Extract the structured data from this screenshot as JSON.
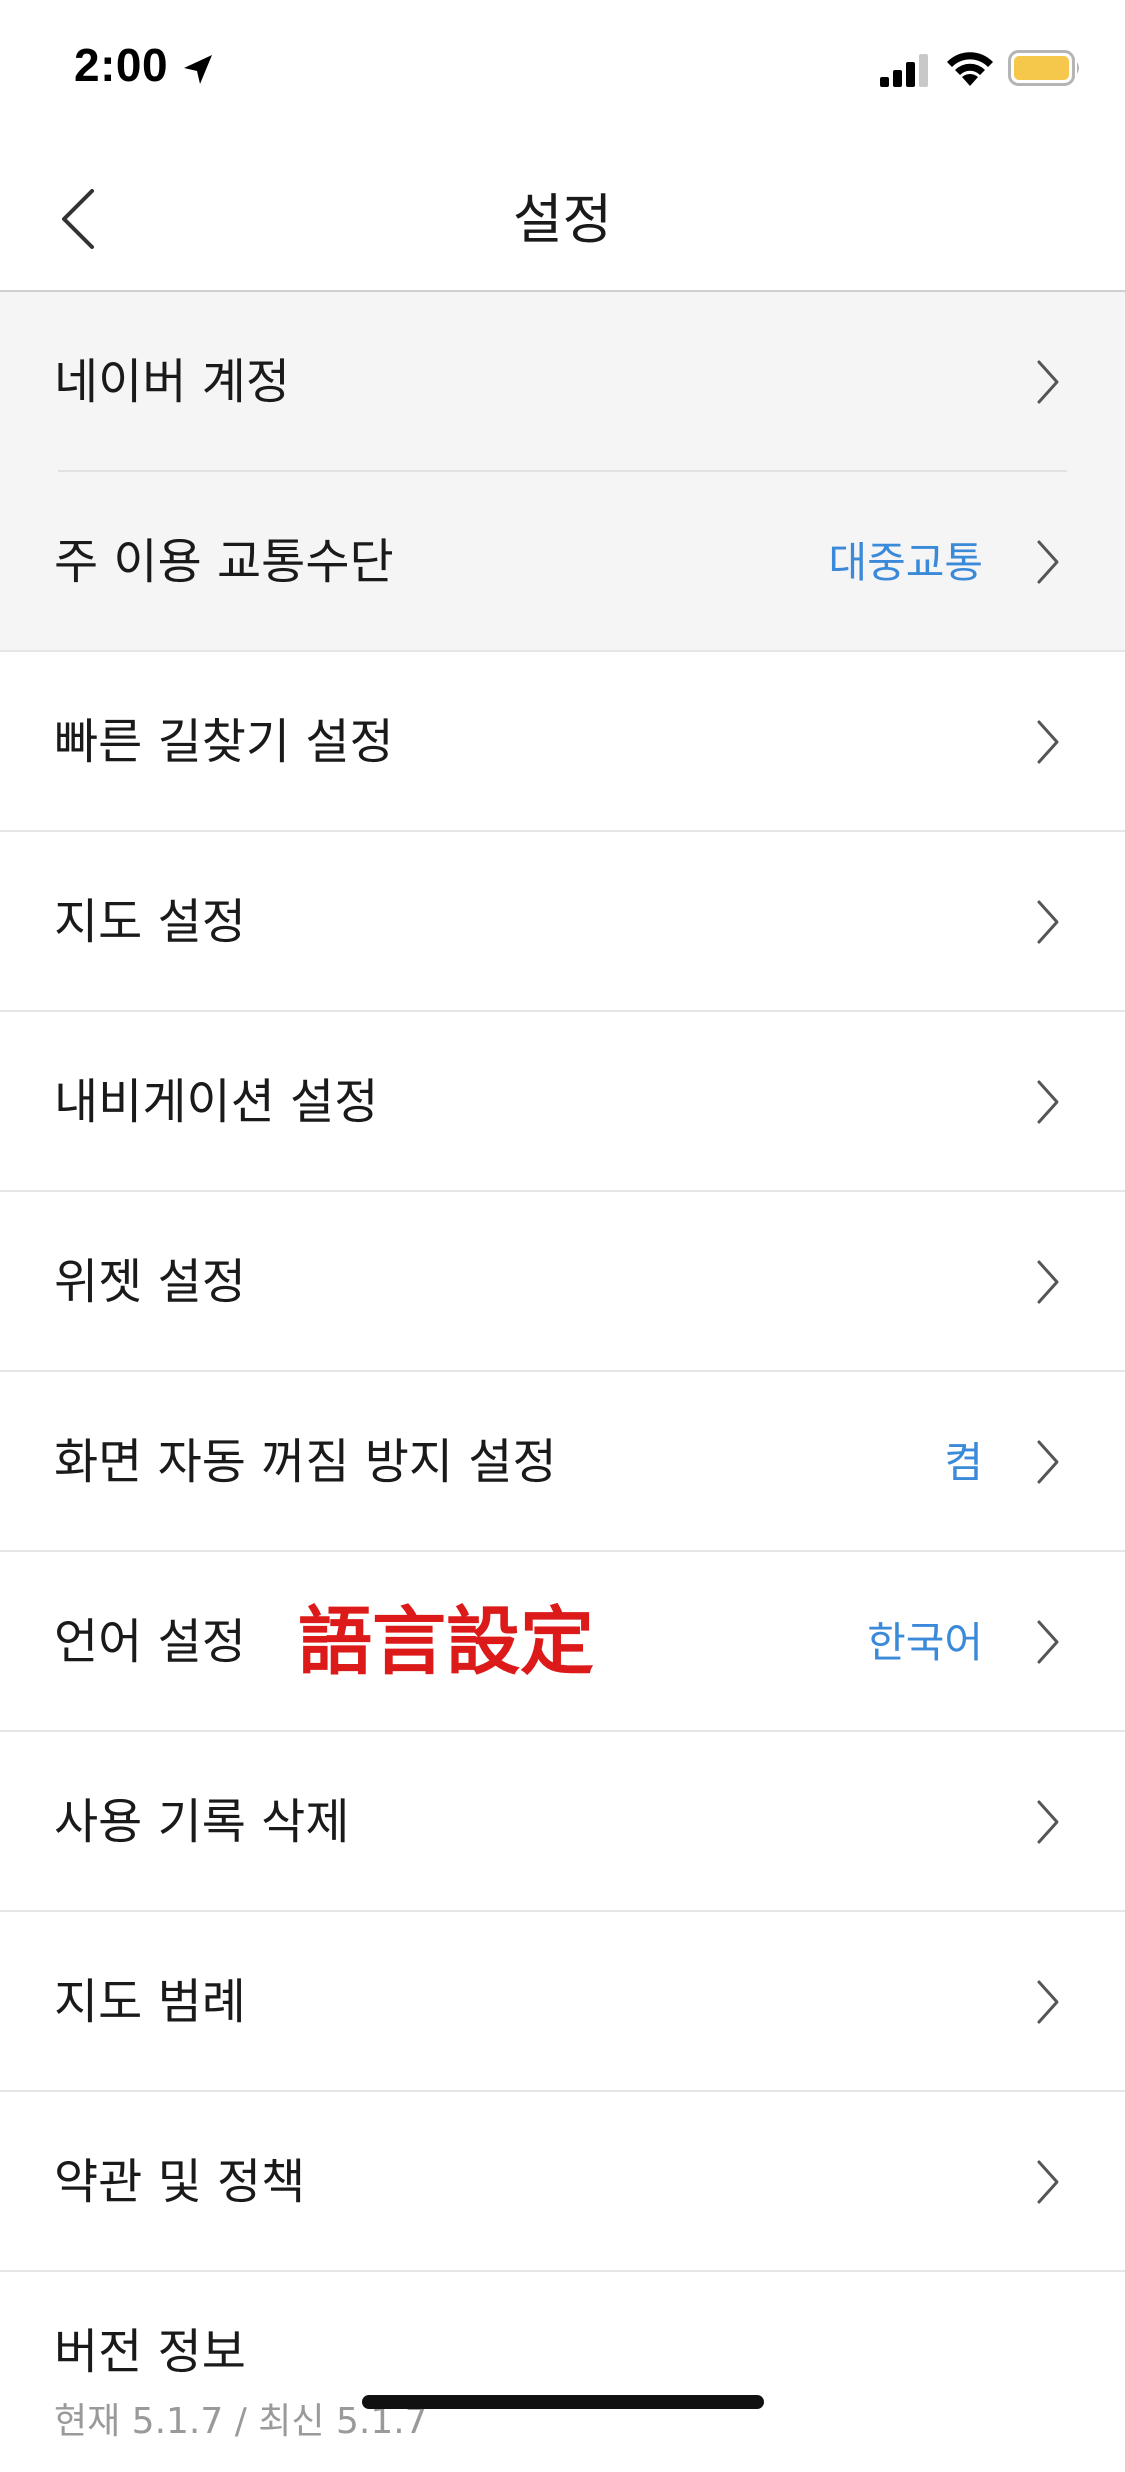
{
  "status_bar": {
    "time": "2:00",
    "icons": [
      "location-arrow-icon",
      "cellular-signal-icon",
      "wifi-icon",
      "battery-icon"
    ],
    "battery_color": "#f5c84c"
  },
  "nav": {
    "title": "설정",
    "back_icon": "chevron-left-icon"
  },
  "colors": {
    "accent": "#3b8ad9",
    "annotation": "#dd1a1a",
    "row_highlight": "#f5f5f5"
  },
  "settings": [
    {
      "label": "네이버 계정",
      "value": ""
    },
    {
      "label": "주 이용 교통수단",
      "value": "대중교통"
    },
    {
      "label": "빠른 길찾기 설정",
      "value": ""
    },
    {
      "label": "지도 설정",
      "value": ""
    },
    {
      "label": "내비게이션 설정",
      "value": ""
    },
    {
      "label": "위젯 설정",
      "value": ""
    },
    {
      "label": "화면 자동 꺼짐 방지 설정",
      "value": "켬"
    },
    {
      "label": "언어 설정",
      "value": "한국어",
      "annotation": "語言設定"
    },
    {
      "label": "사용 기록 삭제",
      "value": ""
    },
    {
      "label": "지도 범례",
      "value": ""
    },
    {
      "label": "약관 및 정책",
      "value": ""
    }
  ],
  "version": {
    "label": "버전 정보",
    "detail": "현재 5.1.7 / 최신 5.1.7"
  }
}
